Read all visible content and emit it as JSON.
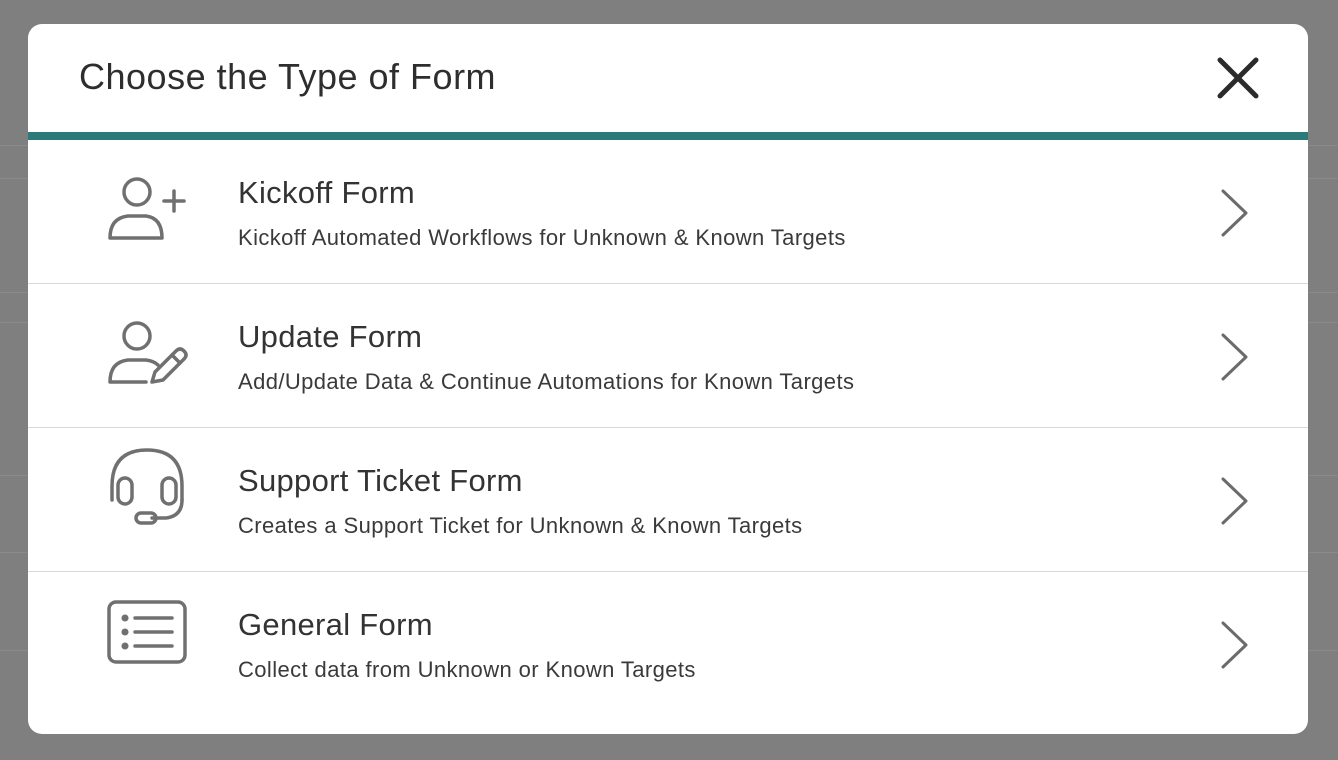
{
  "modal": {
    "title": "Choose the Type of Form",
    "close_icon": "close-icon",
    "accent_color": "#2b7a77"
  },
  "options": [
    {
      "id": "kickoff",
      "icon": "person-add-icon",
      "title": "Kickoff Form",
      "description": "Kickoff Automated Workflows for Unknown & Known Targets"
    },
    {
      "id": "update",
      "icon": "person-edit-icon",
      "title": "Update Form",
      "description": "Add/Update Data & Continue Automations for Known Targets"
    },
    {
      "id": "support-ticket",
      "icon": "headset-icon",
      "title": "Support Ticket Form",
      "description": "Creates a Support Ticket for Unknown & Known Targets"
    },
    {
      "id": "general",
      "icon": "list-icon",
      "title": "General Form",
      "description": "Collect data from Unknown or Known Targets"
    }
  ]
}
